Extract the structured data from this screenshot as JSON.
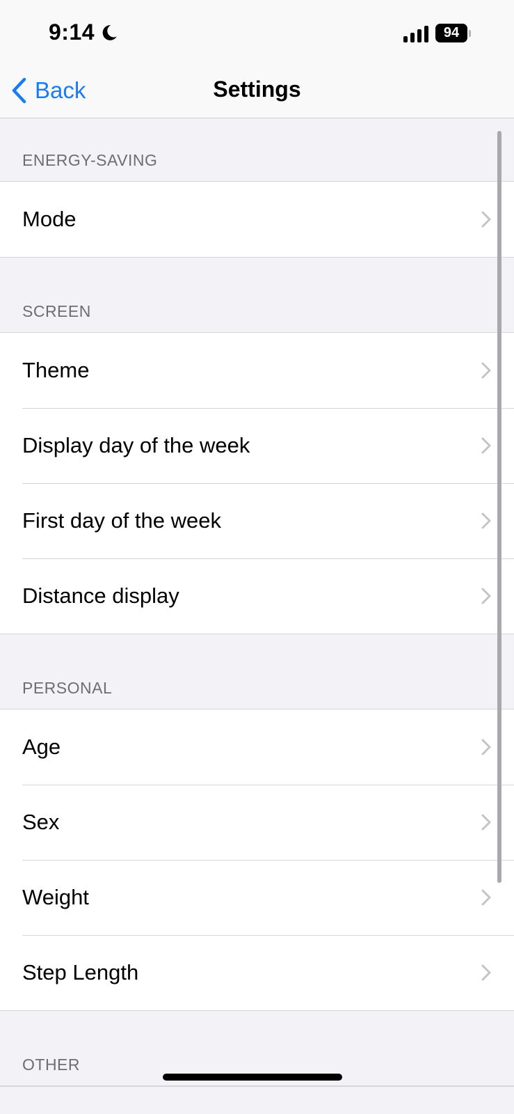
{
  "status_bar": {
    "time": "9:14",
    "battery": "94"
  },
  "nav": {
    "back_label": "Back",
    "title": "Settings"
  },
  "sections": [
    {
      "header": "ENERGY-SAVING",
      "items": [
        "Mode"
      ]
    },
    {
      "header": "SCREEN",
      "items": [
        "Theme",
        "Display day of the week",
        "First day of the week",
        "Distance display"
      ]
    },
    {
      "header": "PERSONAL",
      "items": [
        "Age",
        "Sex",
        "Weight",
        "Step Length"
      ]
    },
    {
      "header": "OTHER",
      "items": []
    }
  ],
  "colors": {
    "accent": "#1a7cf5",
    "background": "#f2f2f7",
    "chevron": "#c4c4c8"
  }
}
